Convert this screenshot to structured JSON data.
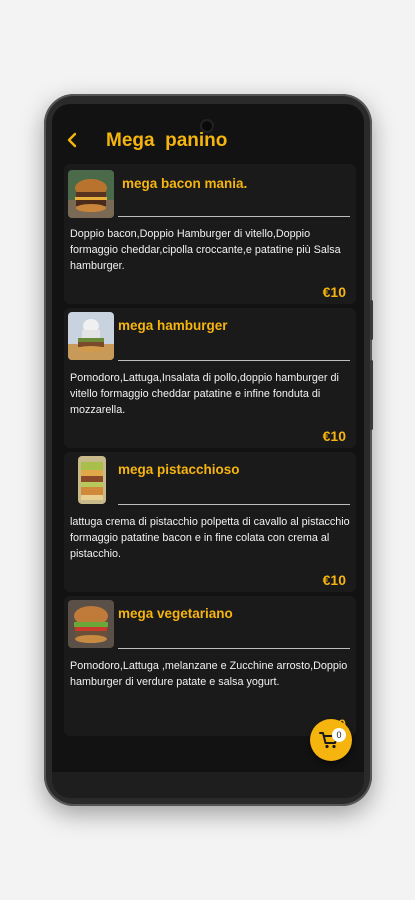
{
  "header": {
    "title": "Mega  panino",
    "back_icon": "chevron-left-icon"
  },
  "colors": {
    "accent": "#f6b40f",
    "background": "#121212",
    "card": "#1a1a1a",
    "text": "#f2f2f2"
  },
  "items": [
    {
      "name": "mega bacon mania.",
      "description": "Doppio bacon,Doppio Hamburger di vitello,Doppio formaggio cheddar,cipolla croccante,e patatine più Salsa hamburger.",
      "price": "€10",
      "image": "burger-photo"
    },
    {
      "name": "mega hamburger",
      "description": "Pomodoro,Lattuga,Insalata di pollo,doppio hamburger di vitello formaggio cheddar patatine e infine fonduta di mozzarella.",
      "price": "€10",
      "image": "burger-photo"
    },
    {
      "name": "mega pistacchioso",
      "description": "lattuga  crema di pistacchio polpetta di cavallo al pistacchio formaggio patatine  bacon e in fine colata con crema al pistacchio.",
      "price": "€10",
      "image": "burger-photo"
    },
    {
      "name": "mega vegetariano",
      "description": "Pomodoro,Lattuga ,melanzane e Zucchine arrosto,Doppio hamburger di verdure patate e salsa yogurt.",
      "price": "€10",
      "image": "burger-photo"
    }
  ],
  "cart": {
    "count": "0",
    "icon": "cart-icon"
  }
}
